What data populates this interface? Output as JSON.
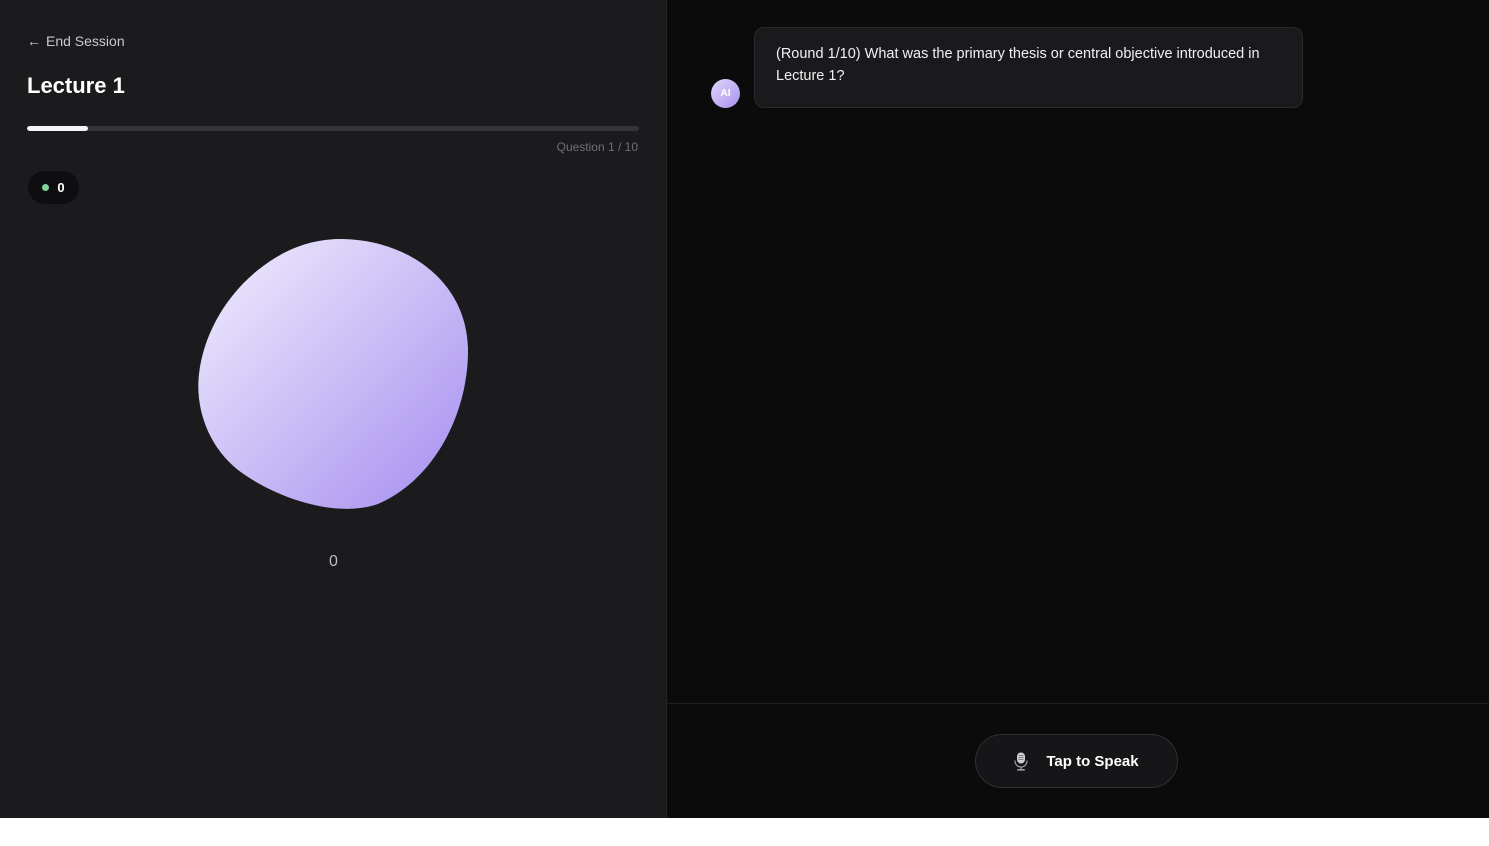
{
  "left_panel": {
    "end_session_label": "End Session",
    "lecture_title": "Lecture 1",
    "progress_fraction": 0.1,
    "question_counter": "Question 1 / 10",
    "score": "0",
    "orb_value": "0"
  },
  "chat": {
    "ai_avatar_label": "AI",
    "messages": [
      {
        "sender": "AI",
        "text": "(Round 1/10) What was the primary thesis or central objective introduced in Lecture 1?"
      }
    ]
  },
  "controls": {
    "speak_button_label": "Tap to Speak"
  },
  "icons": {
    "back": "arrow-left-icon",
    "mic": "microphone-icon",
    "status": "status-dot-icon"
  },
  "colors": {
    "orb_start": "#f3effd",
    "orb_end": "#a48def",
    "status_dot": "#7fd49a",
    "progress_fill": "#f4f4f6"
  }
}
